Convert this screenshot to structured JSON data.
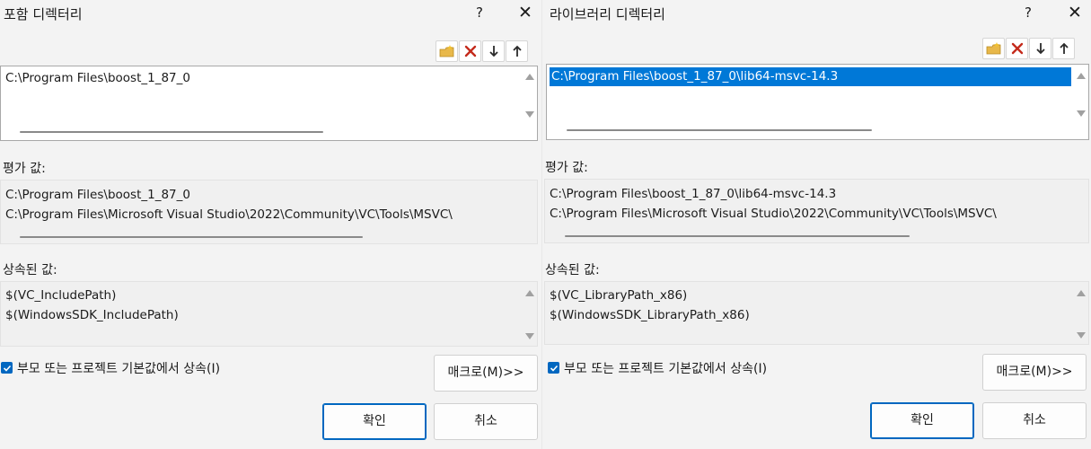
{
  "left": {
    "title": "포함 디렉터리",
    "help": "?",
    "close": "✕",
    "list_items": [
      "C:\\Program Files\\boost_1_87_0"
    ],
    "evaluated_label": "평가 값:",
    "evaluated_lines": [
      "C:\\Program Files\\boost_1_87_0",
      "C:\\Program Files\\Microsoft Visual Studio\\2022\\Community\\VC\\Tools\\MSVC\\"
    ],
    "inherited_label": "상속된 값:",
    "inherited_lines": [
      "$(VC_IncludePath)",
      "$(WindowsSDK_IncludePath)"
    ],
    "inherit_checkbox_label": "부모 또는 프로젝트 기본값에서 상속(I)",
    "inherit_checked": true,
    "macro_button": "매크로(M)>>",
    "ok_button": "확인",
    "cancel_button": "취소"
  },
  "right": {
    "title": "라이브러리 디렉터리",
    "help": "?",
    "close": "✕",
    "list_items": [
      "C:\\Program Files\\boost_1_87_0\\lib64-msvc-14.3"
    ],
    "evaluated_label": "평가 값:",
    "evaluated_lines": [
      "C:\\Program Files\\boost_1_87_0\\lib64-msvc-14.3",
      "C:\\Program Files\\Microsoft Visual Studio\\2022\\Community\\VC\\Tools\\MSVC\\"
    ],
    "inherited_label": "상속된 값:",
    "inherited_lines": [
      "$(VC_LibraryPath_x86)",
      "$(WindowsSDK_LibraryPath_x86)"
    ],
    "inherit_checkbox_label": "부모 또는 프로젝트 기본값에서 상속(I)",
    "inherit_checked": true,
    "macro_button": "매크로(M)>>",
    "ok_button": "확인",
    "cancel_button": "취소"
  },
  "icons": {
    "new_line": "new-folder-icon",
    "delete": "delete-icon",
    "move_down": "arrow-down-icon",
    "move_up": "arrow-up-icon"
  },
  "colors": {
    "selection": "#0078d7",
    "checkbox": "#0067c0",
    "delete_icon": "#c42b1c"
  }
}
